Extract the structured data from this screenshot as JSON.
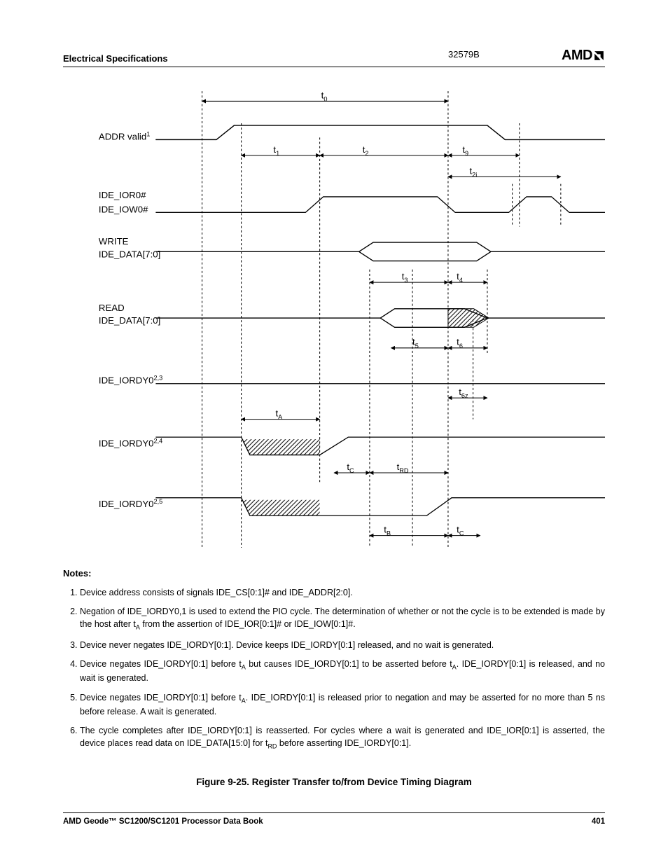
{
  "header": {
    "section": "Electrical Specifications",
    "docnum": "32579B",
    "logo": "AMD"
  },
  "diagram": {
    "signals": {
      "addr": "ADDR valid",
      "addr_sup": "1",
      "ior": "IDE_IOR0#",
      "iow": "IDE_IOW0#",
      "write": "WRITE",
      "write_data": "IDE_DATA[7:0]",
      "read": "READ",
      "read_data": "IDE_DATA[7:0]",
      "iordy_a": "IDE_IORDY0",
      "iordy_a_sup": "2,3",
      "iordy_b": "IDE_IORDY0",
      "iordy_b_sup": "2,4",
      "iordy_c": "IDE_IORDY0",
      "iordy_c_sup": "2,5"
    },
    "timing_labels": {
      "t0": "t",
      "t0s": "0",
      "t1": "t",
      "t1s": "1",
      "t2": "t",
      "t2s": "2",
      "t9": "t",
      "t9s": "9",
      "t2i": "t",
      "t2is": "2i",
      "t3": "t",
      "t3s": "3",
      "t4": "t",
      "t4s": "4",
      "t5": "t",
      "t5s": "5",
      "t6": "t",
      "t6s": "6",
      "t6z": "t",
      "t6zs": "6z",
      "tA": "t",
      "tAs": "A",
      "tC": "t",
      "tCs": "C",
      "tRD": "t",
      "tRDs": "RD",
      "tB": "t",
      "tBs": "B",
      "tC2": "t",
      "tC2s": "C"
    }
  },
  "notes": {
    "heading": "Notes:",
    "items": [
      "Device address consists of signals IDE_CS[0:1]# and IDE_ADDR[2:0].",
      "Negation of IDE_IORDY0,1 is used to extend the PIO cycle. The determination of whether or not the cycle is to be extended is made by the host after t<sub>A</sub> from the assertion of IDE_IOR[0:1]# or IDE_IOW[0:1]#.",
      "Device never negates IDE_IORDY[0:1]. Device keeps IDE_IORDY[0:1] released, and no wait is generated.",
      "Device negates IDE_IORDY[0:1] before t<sub>A</sub> but causes IDE_IORDY[0:1] to be asserted before t<sub>A</sub>. IDE_IORDY[0:1] is released, and no wait is generated.",
      "Device negates IDE_IORDY[0:1] before t<sub>A</sub>. IDE_IORDY[0:1] is released prior to negation and may be asserted for no more than 5 ns before release. A wait is generated.",
      "The cycle completes after IDE_IORDY[0:1] is reasserted. For cycles where a wait is generated and IDE_IOR[0:1] is asserted, the device places read data on IDE_DATA[15:0] for t<sub>RD</sub> before asserting IDE_IORDY[0:1]."
    ]
  },
  "figure_title": "Figure 9-25.  Register Transfer to/from Device Timing Diagram",
  "footer": {
    "left": "AMD Geode™ SC1200/SC1201 Processor Data Book",
    "right": "401"
  }
}
